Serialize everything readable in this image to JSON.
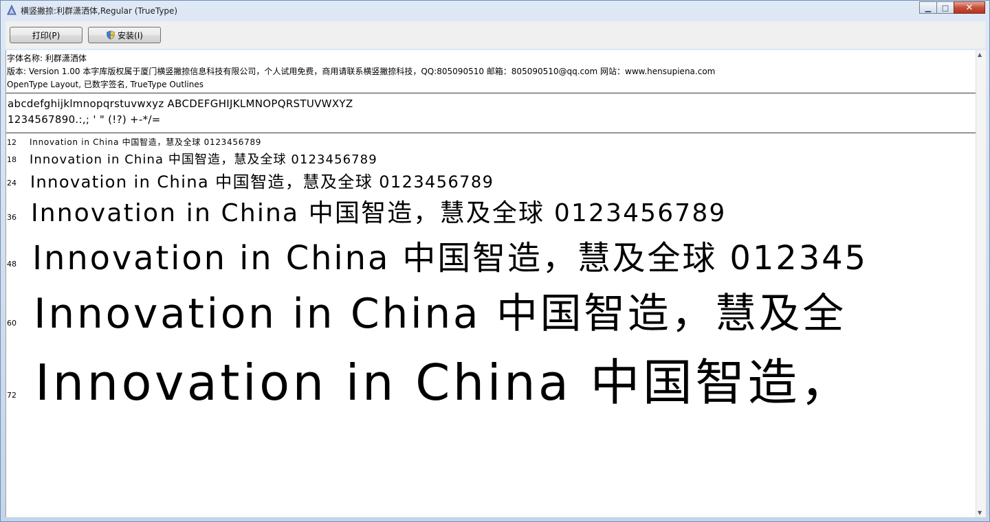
{
  "window": {
    "title": "横竖撇捺:利群潇洒体,Regular (TrueType)",
    "minimize_glyph": "▁",
    "maximize_glyph": "□",
    "close_glyph": "✕"
  },
  "toolbar": {
    "print_label": "打印(P)",
    "install_label": "安装(I)"
  },
  "info": {
    "font_name": "字体名称: 利群潇洒体",
    "version": "版本: Version 1.00 本字库版权属于厦门横竖撇捺信息科技有限公司，个人试用免费，商用请联系横竖撇捺科技，QQ:805090510 邮箱：805090510@qq.com 网站：www.hensupiena.com",
    "features": "OpenType Layout, 已数字签名, TrueType Outlines"
  },
  "charset": {
    "letters": "abcdefghijklmnopqrstuvwxyz ABCDEFGHIJKLMNOPQRSTUVWXYZ",
    "digits": "1234567890.:,; ' \" (!?) +-*/="
  },
  "samples": [
    {
      "size": "12",
      "text": "Innovation in China 中国智造，慧及全球 0123456789"
    },
    {
      "size": "18",
      "text": "Innovation in China 中国智造，慧及全球 0123456789"
    },
    {
      "size": "24",
      "text": "Innovation in China 中国智造，慧及全球 0123456789"
    },
    {
      "size": "36",
      "text": "Innovation in China 中国智造，慧及全球 0123456789"
    },
    {
      "size": "48",
      "text": "Innovation in China 中国智造，慧及全球 012345"
    },
    {
      "size": "60",
      "text": "Innovation in China 中国智造，慧及全"
    },
    {
      "size": "72",
      "text": "Innovation in China 中国智造，"
    }
  ]
}
